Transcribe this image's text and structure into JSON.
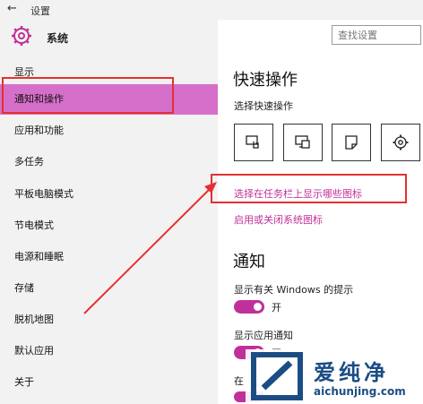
{
  "titlebar": {
    "title": "设置"
  },
  "header": {
    "section": "系统"
  },
  "search": {
    "placeholder": "查找设置"
  },
  "sidebar": {
    "items": [
      {
        "label": "显示"
      },
      {
        "label": "通知和操作",
        "active": true
      },
      {
        "label": "应用和功能"
      },
      {
        "label": "多任务"
      },
      {
        "label": "平板电脑模式"
      },
      {
        "label": "节电模式"
      },
      {
        "label": "电源和睡眠"
      },
      {
        "label": "存储"
      },
      {
        "label": "脱机地图"
      },
      {
        "label": "默认应用"
      },
      {
        "label": "关于"
      }
    ]
  },
  "main": {
    "quick_title": "快速操作",
    "quick_subtitle": "选择快速操作",
    "quick_buttons": [
      "tablet-mode-icon",
      "project-icon",
      "note-icon",
      "settings-icon"
    ],
    "link1": "选择在任务栏上显示哪些图标",
    "link2": "启用或关闭系统图标",
    "notify_title": "通知",
    "opt1_label": "显示有关 Windows 的提示",
    "opt1_state": "开",
    "opt2_label": "显示应用通知",
    "opt2_state": "开",
    "opt3_label": "在"
  },
  "watermark": {
    "line1": "爱纯净",
    "line2": "aichunjing.com"
  },
  "colors": {
    "accent": "#c0309a",
    "active_bg": "#d66fc9",
    "annotation": "#e53030",
    "watermark": "#1b4d84"
  }
}
